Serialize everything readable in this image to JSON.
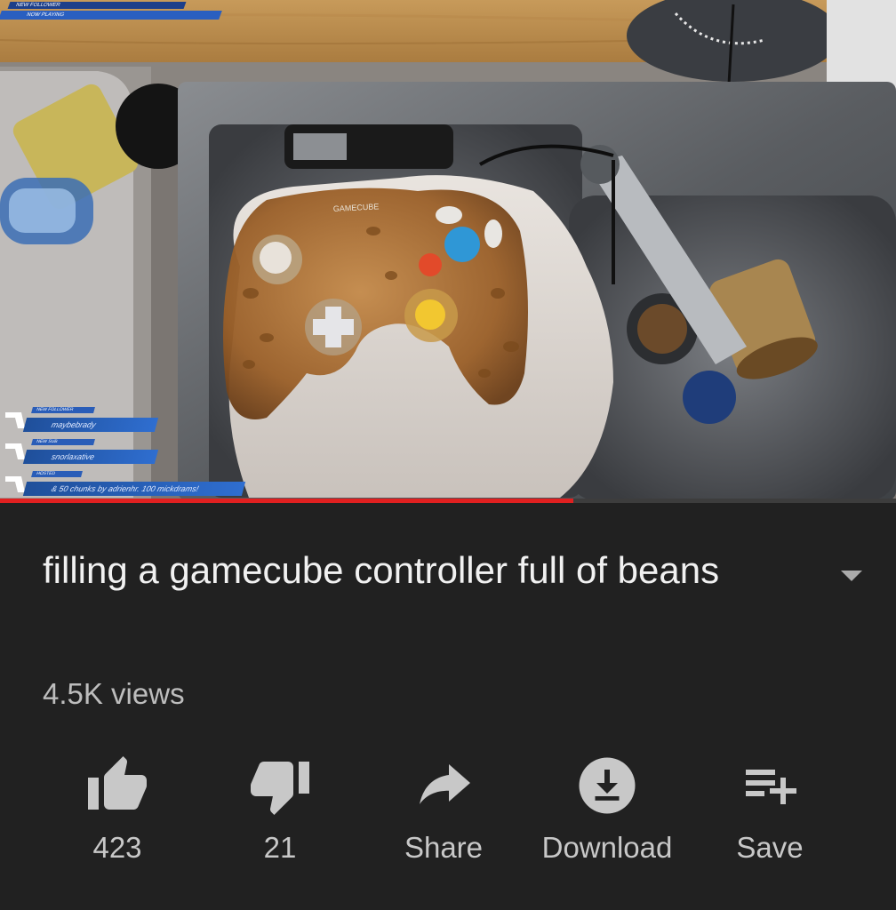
{
  "video": {
    "progress_fraction": 0.64,
    "overlay": {
      "top_banner_line1": "NEW FOLLOWER",
      "top_banner_line2": "NOW PLAYING",
      "chat": [
        {
          "tag": "NEW FOLLOWER",
          "text": "maybebrady"
        },
        {
          "tag": "NEW SUB",
          "text": "snorlaxative"
        },
        {
          "tag": "HOSTED",
          "text": "& 50 chunks by adrienhr. 100 mickdrams!"
        }
      ]
    }
  },
  "title": "filling a gamecube controller full of beans",
  "views": "4.5K views",
  "actions": [
    {
      "id": "like",
      "label": "423",
      "icon": "thumbs-up-icon"
    },
    {
      "id": "dislike",
      "label": "21",
      "icon": "thumbs-down-icon"
    },
    {
      "id": "share",
      "label": "Share",
      "icon": "share-arrow-icon"
    },
    {
      "id": "download",
      "label": "Download",
      "icon": "download-icon"
    },
    {
      "id": "save",
      "label": "Save",
      "icon": "playlist-add-icon"
    }
  ],
  "colors": {
    "background": "#212121",
    "progress": "#e02020",
    "text": "#f1f1f1",
    "secondary_text": "#bdbdbd"
  }
}
